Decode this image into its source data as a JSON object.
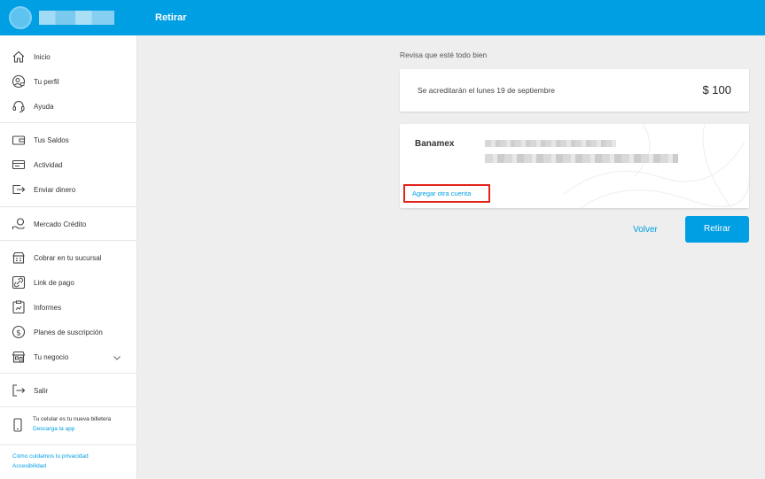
{
  "header": {
    "title": "Retirar"
  },
  "sidebar": {
    "items": [
      {
        "label": "Inicio",
        "icon": "home-icon"
      },
      {
        "label": "Tu perfil",
        "icon": "profile-icon"
      },
      {
        "label": "Ayuda",
        "icon": "headset-icon"
      },
      {
        "label": "Tus Saldos",
        "icon": "wallet-icon"
      },
      {
        "label": "Actividad",
        "icon": "activity-icon"
      },
      {
        "label": "Enviar dinero",
        "icon": "send-money-icon"
      },
      {
        "label": "Mercado Crédito",
        "icon": "credit-icon"
      },
      {
        "label": "Cobrar en tu sucursal",
        "icon": "store-icon"
      },
      {
        "label": "Link de pago",
        "icon": "link-icon"
      },
      {
        "label": "Informes",
        "icon": "reports-icon"
      },
      {
        "label": "Planes de suscripción",
        "icon": "dollar-circle-icon"
      },
      {
        "label": "Tu negocio",
        "icon": "business-icon"
      },
      {
        "label": "Salir",
        "icon": "logout-icon"
      }
    ],
    "promo": {
      "text": "Tu celular es tu nueva billetera",
      "link": "Descarga la app"
    },
    "footer": {
      "privacy": "Cómo cuidamos tu privacidad",
      "accessibility": "Accesibilidad"
    }
  },
  "main": {
    "review_title": "Revisa que esté todo bien",
    "credit_text": "Se acreditarán el lunes 19 de septiembre",
    "amount": "$ 100",
    "bank_name": "Banamex",
    "add_account": "Agregar otra cuenta",
    "back_label": "Volver",
    "withdraw_label": "Retirar"
  },
  "colors": {
    "primary": "#009ee3",
    "highlight": "#e3241b",
    "background": "#eeeeee"
  }
}
